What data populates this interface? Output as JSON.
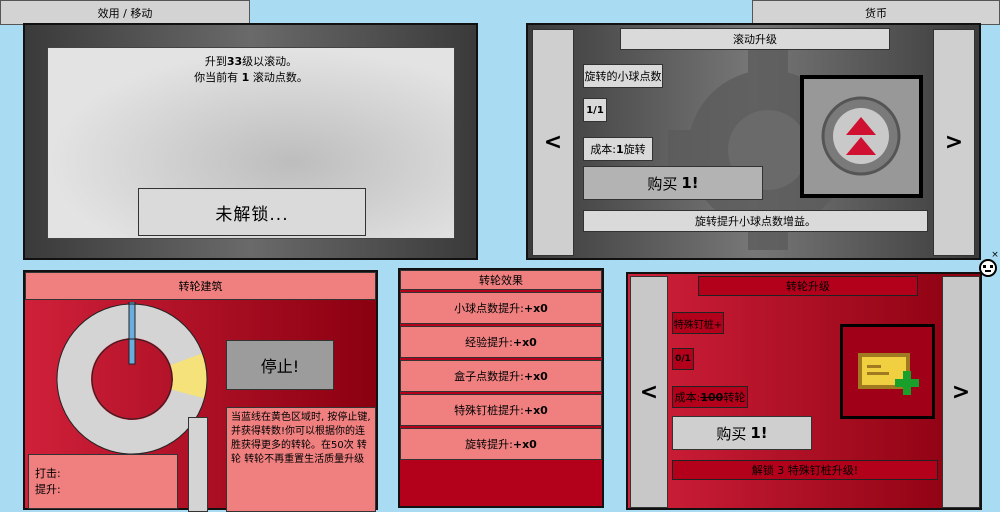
{
  "tabs": {
    "left": "效用 / 移动",
    "right": "货币"
  },
  "scroll_panel": {
    "line1_pre": "升到",
    "line1_num": "33",
    "line1_post": "级以滚动。",
    "line2_pre": "你当前有 ",
    "line2_num": "1",
    "line2_post": " 滚动点数。",
    "locked_button": "未解锁..."
  },
  "scroll_upgrade": {
    "title": "滚动升级",
    "name": "旋转的小球点数",
    "level": "1/1",
    "cost_pre": "成本: ",
    "cost_num": "1",
    "cost_post": " 旋转",
    "buy_pre": "购买 ",
    "buy_num": "1!",
    "description": "旋转提升小球点数增益。",
    "prev": "<",
    "next": ">"
  },
  "wheel": {
    "title": "转轮建筑",
    "stop_button": "停止!",
    "info": "当蓝线在黄色区域时, 按停止键, 并获得转数!你可以根据你的连胜获得更多的转轮。在50次 转轮 转轮不再重置生活质量升级",
    "hit_label": "打击:",
    "boost_label": "提升:",
    "colors": {
      "ring": "#d4d4d4",
      "target": "#f5e27a",
      "needle": "#6aaee0"
    }
  },
  "wheel_effects": {
    "title": "转轮效果",
    "items": [
      {
        "label": "小球点数提升: ",
        "value": "+x0"
      },
      {
        "label": "经验提升: ",
        "value": "+x0"
      },
      {
        "label": "盒子点数提升: ",
        "value": "+x0"
      },
      {
        "label": "特殊钉桩提升: ",
        "value": "+x0"
      },
      {
        "label": "旋转提升: ",
        "value": "+x0"
      }
    ]
  },
  "wheel_upgrade": {
    "title": "转轮升级",
    "name": "特殊钉桩+",
    "level": "0/1",
    "cost_pre": "成本: ",
    "cost_num": "100",
    "cost_post": " 转轮",
    "buy_pre": "购买 ",
    "buy_num": "1!",
    "description": "解锁 3 特殊钉桩升级!",
    "prev": "<",
    "next": ">"
  },
  "close_glyph": "×"
}
